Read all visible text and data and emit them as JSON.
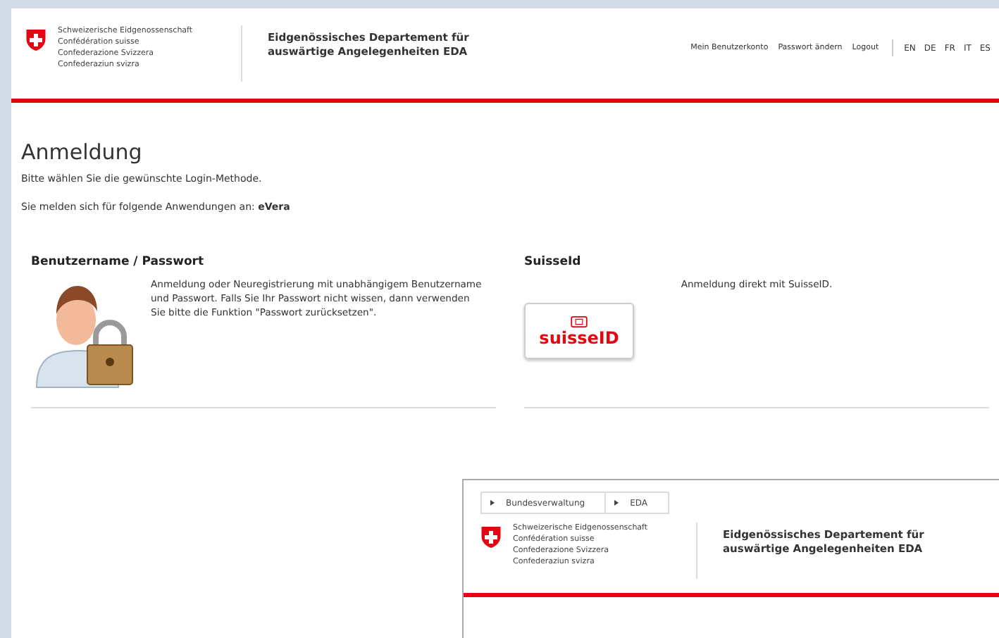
{
  "header": {
    "federation_names": [
      "Schweizerische Eidgenossenschaft",
      "Confédération suisse",
      "Confederazione Svizzera",
      "Confederaziun svizra"
    ],
    "department": [
      "Eidgenössisches Departement für",
      "auswärtige Angelegenheiten EDA"
    ],
    "nav_links": [
      "Mein Benutzerkonto",
      "Passwort ändern",
      "Logout"
    ],
    "languages": [
      "EN",
      "DE",
      "FR",
      "IT",
      "ES"
    ]
  },
  "content": {
    "title": "Anmeldung",
    "intro": "Bitte wählen Sie die gewünschte Login-Methode.",
    "applications": "Sie melden sich für folgende Anwendungen an: **eVera**",
    "methods": [
      {
        "kind": "password",
        "heading": "Benutzername / Passwort",
        "description": "Anmeldung oder Neuregistrierung mit unabhängigem Benutzername und Passwort. Falls Sie Ihr Passwort nicht wissen, dann verwenden Sie bitte die Funktion \"Passwort zurücksetzen\"."
      },
      {
        "kind": "suisseid",
        "heading": "SuisseId",
        "description": "Anmeldung direkt mit SuisseID.",
        "logo_text": "suisseID"
      }
    ]
  },
  "overlay_window": {
    "breadcrumbs": [
      "Bundesverwaltung",
      "EDA"
    ],
    "federation_names": [
      "Schweizerische Eidgenossenschaft",
      "Confédération suisse",
      "Confederazione Svizzera",
      "Confederaziun svizra"
    ],
    "department": [
      "Eidgenössisches Departement für",
      "auswärtige Angelegenheiten EDA"
    ]
  }
}
